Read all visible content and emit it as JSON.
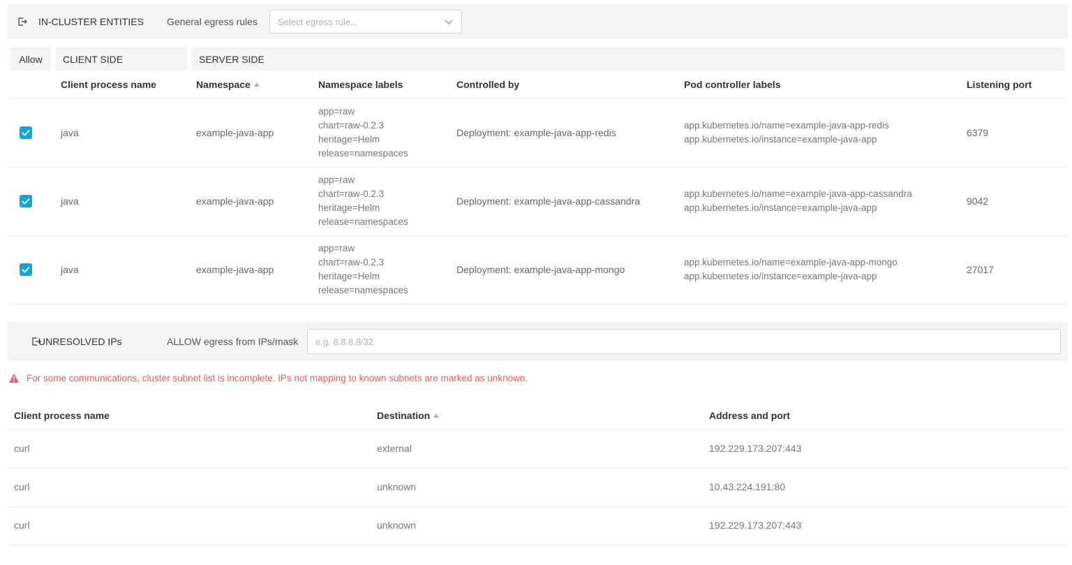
{
  "in_cluster": {
    "title": "IN-CLUSTER ENTITIES",
    "egress_label": "General egress rules",
    "egress_select_placeholder": "Select egress rule..."
  },
  "groups": {
    "allow": "Allow",
    "client_side": "CLIENT SIDE",
    "server_side": "SERVER SIDE"
  },
  "columns": {
    "client_process_name": "Client process name",
    "namespace": "Namespace",
    "namespace_labels": "Namespace labels",
    "controlled_by": "Controlled by",
    "pod_controller_labels": "Pod controller labels",
    "listening_port": "Listening port"
  },
  "entities": [
    {
      "allowed": true,
      "client": "java",
      "namespace": "example-java-app",
      "ns_labels": [
        "app=raw",
        "chart=raw-0.2.3",
        "heritage=Helm",
        "release=namespaces"
      ],
      "controlled_by": "Deployment: example-java-app-redis",
      "pod_labels": [
        "app.kubernetes.io/name=example-java-app-redis",
        "app.kubernetes.io/instance=example-java-app"
      ],
      "port": "6379"
    },
    {
      "allowed": true,
      "client": "java",
      "namespace": "example-java-app",
      "ns_labels": [
        "app=raw",
        "chart=raw-0.2.3",
        "heritage=Helm",
        "release=namespaces"
      ],
      "controlled_by": "Deployment: example-java-app-cassandra",
      "pod_labels": [
        "app.kubernetes.io/name=example-java-app-cassandra",
        "app.kubernetes.io/instance=example-java-app"
      ],
      "port": "9042"
    },
    {
      "allowed": true,
      "client": "java",
      "namespace": "example-java-app",
      "ns_labels": [
        "app=raw",
        "chart=raw-0.2.3",
        "heritage=Helm",
        "release=namespaces"
      ],
      "controlled_by": "Deployment: example-java-app-mongo",
      "pod_labels": [
        "app.kubernetes.io/name=example-java-app-mongo",
        "app.kubernetes.io/instance=example-java-app"
      ],
      "port": "27017"
    }
  ],
  "unresolved": {
    "title": "UNRESOLVED IPs",
    "allow_label": "ALLOW egress from IPs/mask",
    "input_placeholder": "e.g. 8.8.8.8/32",
    "input_value": ""
  },
  "warning": "For some communications, cluster subnet list is incomplete. IPs not mapping to known subnets are marked as unknown.",
  "ip_columns": {
    "client_process_name": "Client process name",
    "destination": "Destination",
    "address_port": "Address and port"
  },
  "ip_rows": [
    {
      "client": "curl",
      "destination": "external",
      "address": "192.229.173.207:443"
    },
    {
      "client": "curl",
      "destination": "unknown",
      "address": "10.43.224.191:80"
    },
    {
      "client": "curl",
      "destination": "unknown",
      "address": "192.229.173.207:443"
    }
  ],
  "colors": {
    "accent": "#1aa3cf",
    "warning": "#ef5b5b",
    "bar_bg": "#f4f4f4"
  }
}
